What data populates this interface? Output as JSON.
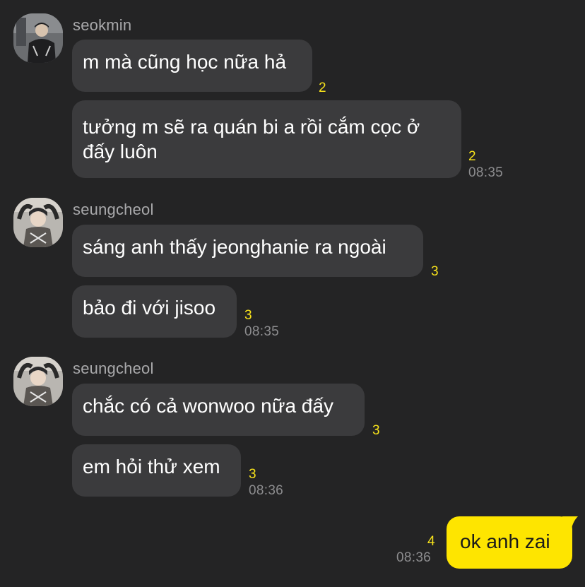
{
  "groups": [
    {
      "sender": "seokmin",
      "messages": [
        {
          "text": "m mà cũng học nữa hả",
          "unread": "2"
        },
        {
          "text": "tưởng m sẽ ra quán bi a rồi cắm cọc ở đấy luôn",
          "unread": "2",
          "time": "08:35"
        }
      ]
    },
    {
      "sender": "seungcheol",
      "messages": [
        {
          "text": "sáng anh thấy jeonghanie ra ngoài",
          "unread": "3"
        },
        {
          "text": "bảo đi với jisoo",
          "unread": "3",
          "time": "08:35"
        }
      ]
    },
    {
      "sender": "seungcheol",
      "messages": [
        {
          "text": "chắc có cả wonwoo nữa đấy",
          "unread": "3"
        },
        {
          "text": "em hỏi thử xem",
          "unread": "3",
          "time": "08:36"
        }
      ]
    }
  ],
  "my_message": {
    "text": "ok anh zai",
    "unread": "4",
    "time": "08:36"
  },
  "colors": {
    "background": "#242425",
    "incoming_bubble": "#3b3b3d",
    "outgoing_bubble": "#fee500",
    "unread_count": "#f7e21b",
    "timestamp": "#8c8c8e"
  }
}
